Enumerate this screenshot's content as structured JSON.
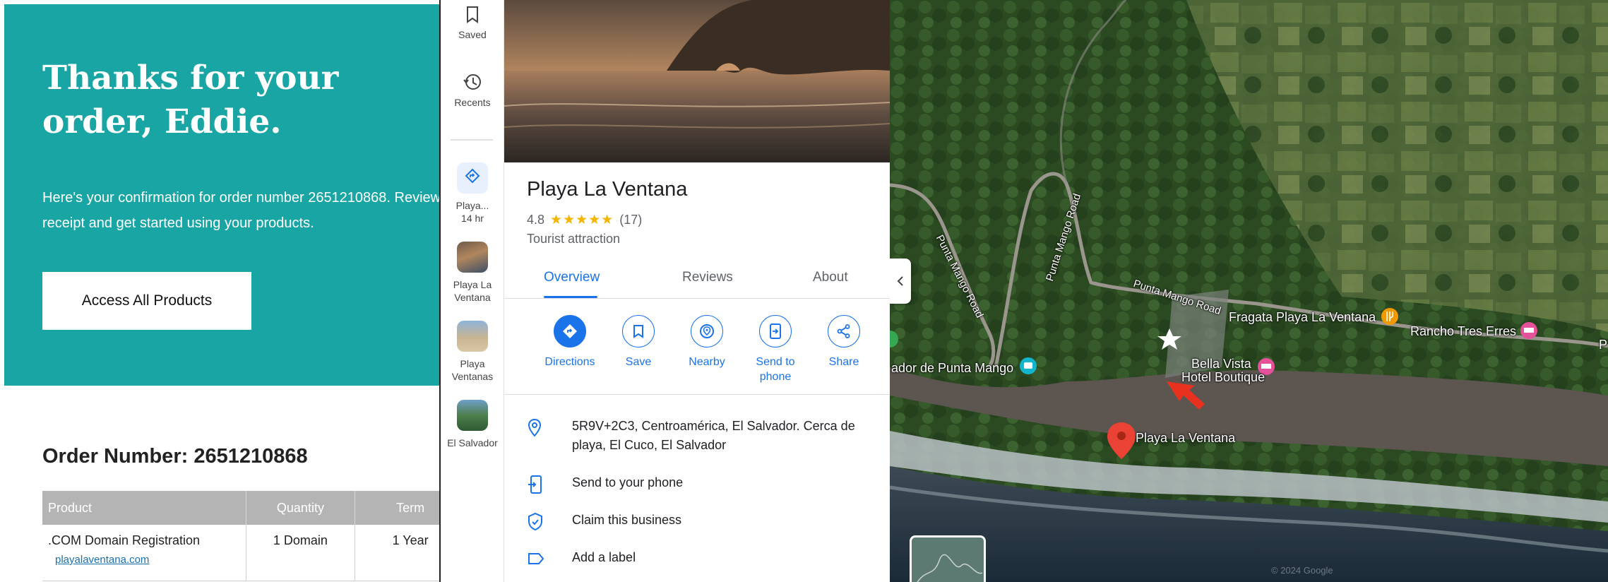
{
  "email": {
    "greeting": "Thanks for your order, Eddie.",
    "confirmation_text": "Here's your confirmation for order number 2651210868. Review your receipt and get started using your products.",
    "access_button_label": "Access All Products",
    "order_number_label": "Order Number: 2651210868",
    "table": {
      "headers": [
        "Product",
        "Quantity",
        "Term"
      ],
      "rows": [
        {
          "product": ".COM Domain Registration",
          "domain": "playalaventana.com",
          "quantity": "1 Domain",
          "term": "1 Year"
        }
      ]
    },
    "hero_color": "#1aa5a5"
  },
  "maps_rail": {
    "saved_label": "Saved",
    "recents_label": "Recents",
    "items": [
      {
        "label": "Playa...",
        "sublabel": "14 hr"
      },
      {
        "label": "Playa La Ventana"
      },
      {
        "label": "Playa Ventanas"
      },
      {
        "label": "El Salvador"
      }
    ]
  },
  "place": {
    "title": "Playa La Ventana",
    "rating": "4.8",
    "stars": "★★★★★",
    "review_count": "(17)",
    "category": "Tourist attraction",
    "tabs": [
      {
        "label": "Overview",
        "active": true
      },
      {
        "label": "Reviews",
        "active": false
      },
      {
        "label": "About",
        "active": false
      }
    ],
    "actions": [
      {
        "label": "Directions",
        "icon": "directions-icon"
      },
      {
        "label": "Save",
        "icon": "bookmark-icon"
      },
      {
        "label": "Nearby",
        "icon": "nearby-icon"
      },
      {
        "label": "Send to phone",
        "icon": "send-to-phone-icon"
      },
      {
        "label": "Share",
        "icon": "share-icon"
      }
    ],
    "info": {
      "address": "5R9V+2C3, Centroamérica, El Salvador. Cerca de playa, El Cuco, El Salvador",
      "send_to_phone": "Send to your phone",
      "claim": "Claim this business",
      "label": "Add a label"
    },
    "accent_color": "#1a73e8"
  },
  "map": {
    "place_pin_label": "Playa La Ventana",
    "roads": [
      "Punta Mango Road",
      "Punta Mango Road",
      "Punta Mango Road"
    ],
    "pois": {
      "fragata": "Fragata Playa La Ventana",
      "rancho": "Rancho Tres Erres",
      "bella_line1": "Bella Vista",
      "bella_line2": "Hotel Boutique",
      "mirador": "ador de Punta Mango",
      "edge_p": "P"
    },
    "copyright": "© 2024 Google"
  }
}
